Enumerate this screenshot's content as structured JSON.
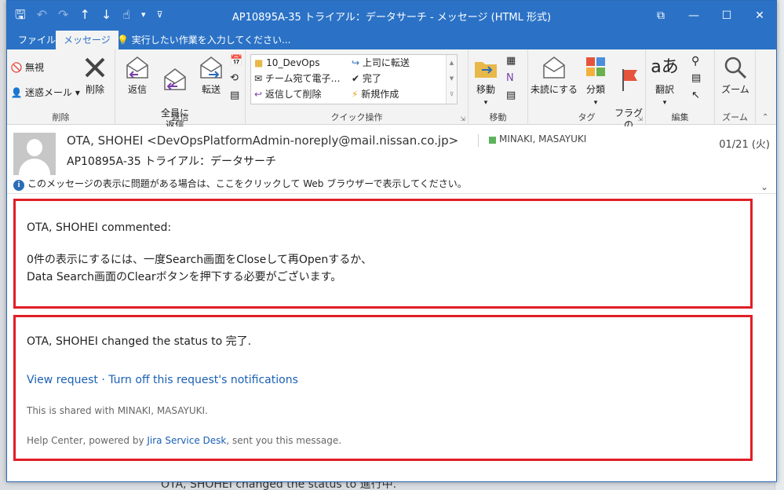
{
  "titlebar": {
    "title": "AP10895A-35 トライアル：データサーチ - メッセージ (HTML 形式)",
    "qat": {
      "save": "🖫",
      "undo": "↶",
      "redo": "↷",
      "up": "↑",
      "down": "↓",
      "touch": "☝",
      "more": "▾",
      "customize": "⊽"
    },
    "buttons": {
      "restore": "⧉",
      "minimize": "—",
      "maximize": "☐",
      "close": "✕"
    }
  },
  "tabs": {
    "file": "ファイル",
    "message": "メッセージ",
    "tellme": "💡 実行したい作業を入力してください..."
  },
  "ribbon": {
    "delete_group": {
      "ignore": "無視",
      "junk": "迷惑メール",
      "delete": "削除",
      "label": "削除"
    },
    "respond_group": {
      "reply": "返信",
      "reply_all": "全員に\n返信",
      "forward": "転送",
      "label": "返信"
    },
    "quick_steps": {
      "items": [
        "10_DevOps",
        "チーム宛て電子…",
        "返信して削除",
        "上司に転送",
        "完了",
        "新規作成"
      ],
      "label": "クイック操作"
    },
    "move_group": {
      "move": "移動",
      "label": "移動"
    },
    "tags_group": {
      "unread": "未読にする",
      "categorize": "分類",
      "followup": "フラグの\n設定",
      "label": "タグ"
    },
    "editing_group": {
      "translate": "翻訳",
      "label": "編集"
    },
    "zoom_group": {
      "zoom": "ズーム",
      "label": "ズーム"
    }
  },
  "header": {
    "sender": "OTA, SHOHEI <DevOpsPlatformAdmin-noreply@mail.nissan.co.jp>",
    "recipient": "MINAKI, MASAYUKI",
    "date": "01/21 (火)",
    "subject": "AP10895A-35 トライアル：データサーチ",
    "info": "このメッセージの表示に問題がある場合は、ここをクリックして Web ブラウザーで表示してください。"
  },
  "body": {
    "comment_header": "OTA, SHOHEI commented:",
    "comment_line1": "0件の表示にするには、一度Search画面をCloseして再Openするか、",
    "comment_line2": "Data Search画面のClearボタンを押下する必要がございます。",
    "status_change": "OTA, SHOHEI changed the status to 完了.",
    "view_request": "View request",
    "link_separator": " · ",
    "turn_off": "Turn off this request's notifications",
    "shared_with": "This is shared with MINAKI, MASAYUKI.",
    "footer_prefix": "Help Center, powered by ",
    "footer_link": "Jira Service Desk",
    "footer_suffix": ", sent you this message."
  },
  "background": {
    "text": "OTA, SHOHEI changed the status to 進行中."
  },
  "colors": {
    "accent": "#2b72c6",
    "highlight_box": "#e01e26",
    "link": "#1a5fb4",
    "presence": "#5db35d"
  }
}
